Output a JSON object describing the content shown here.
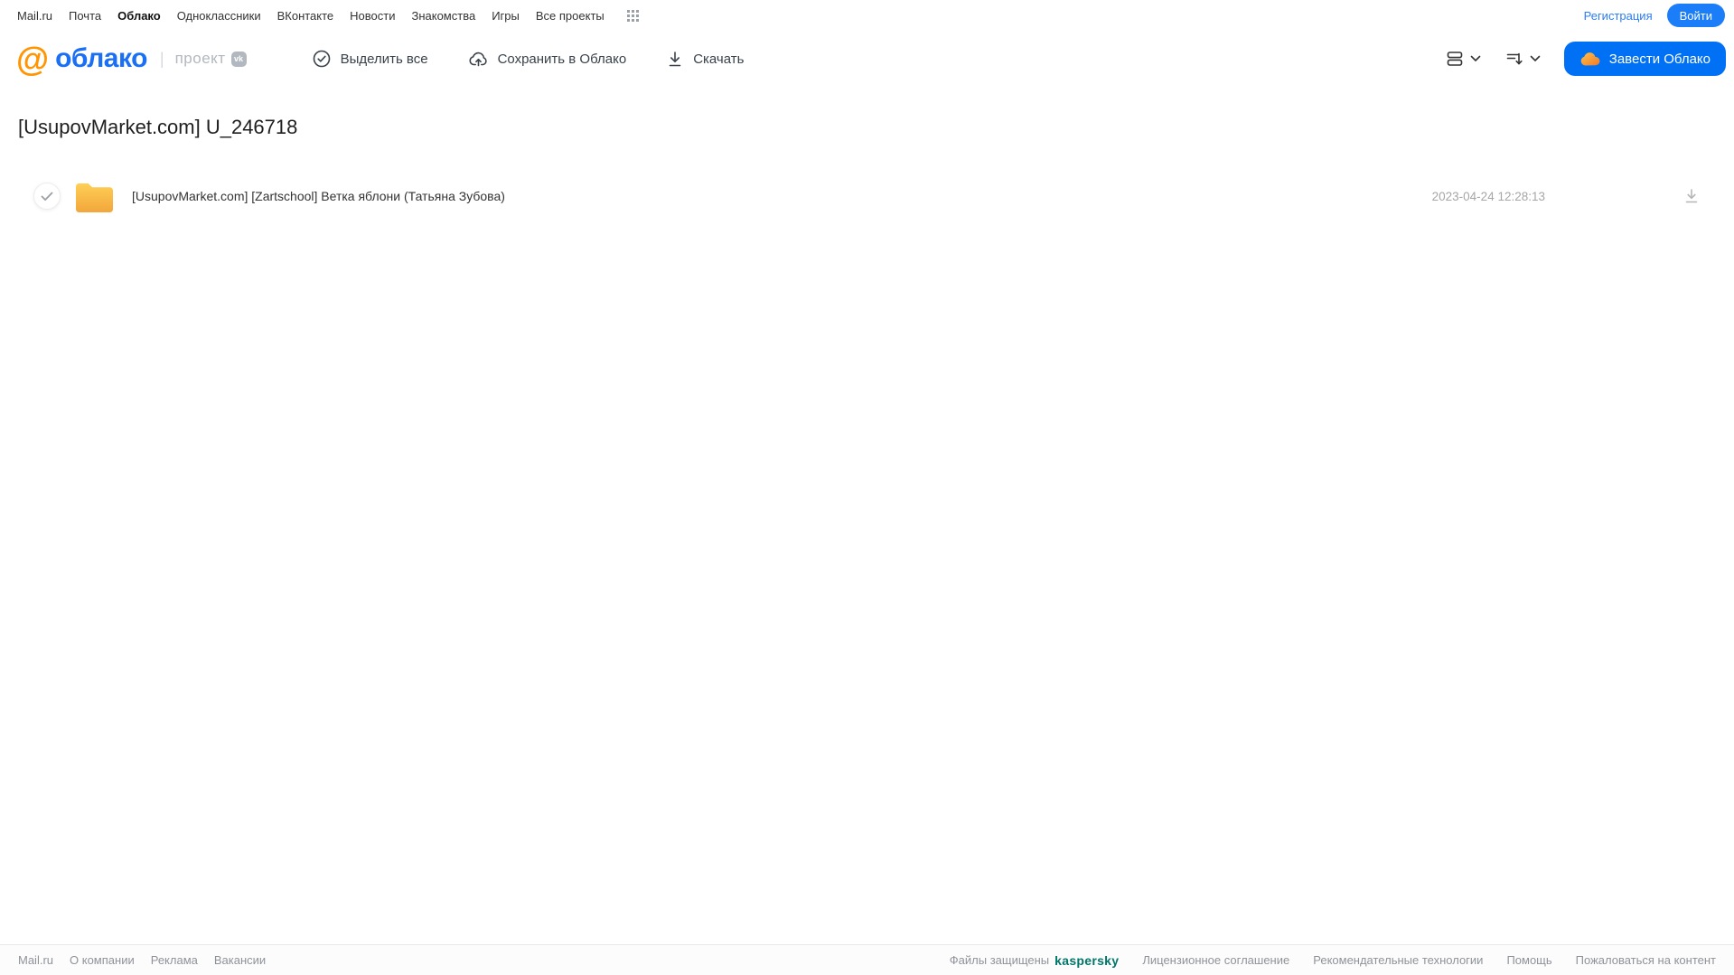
{
  "topnav": {
    "links": [
      {
        "label": "Mail.ru"
      },
      {
        "label": "Почта"
      },
      {
        "label": "Облако"
      },
      {
        "label": "Одноклассники"
      },
      {
        "label": "ВКонтакте"
      },
      {
        "label": "Новости"
      },
      {
        "label": "Знакомства"
      },
      {
        "label": "Игры"
      },
      {
        "label": "Все проекты"
      }
    ],
    "register_label": "Регистрация",
    "login_label": "Войти"
  },
  "header": {
    "logo_at": "@",
    "logo_text": "облако",
    "project_separator": "|",
    "project_label": "проект",
    "vk_badge": "vk",
    "toolbar": {
      "select_all_label": "Выделить все",
      "save_to_cloud_label": "Сохранить в Облако",
      "download_label": "Скачать"
    },
    "get_cloud_label": "Завести Облако"
  },
  "page": {
    "title": "[UsupovMarket.com] U_246718"
  },
  "file_list": {
    "rows": [
      {
        "type": "folder",
        "name": "[UsupovMarket.com] [Zartschool] Ветка яблони (Татьяна Зубова)",
        "date": "2023-04-24 12:28:13"
      }
    ]
  },
  "footer": {
    "left_links": [
      "Mail.ru",
      "О компании",
      "Реклама",
      "Вакансии"
    ],
    "protected_label": "Файлы защищены",
    "kaspersky_label": "kaspersky",
    "right_links": [
      "Лицензионное соглашение",
      "Рекомендательные технологии",
      "Помощь",
      "Пожаловаться на контент"
    ]
  },
  "colors": {
    "accent_blue": "#0070f5",
    "logo_blue": "#1a6ff5",
    "logo_orange": "#ff9500",
    "folder_top": "#ffcf55",
    "folder_bottom": "#f2a63b",
    "kaspersky_green": "#007669",
    "grey_text": "#8f9399"
  }
}
